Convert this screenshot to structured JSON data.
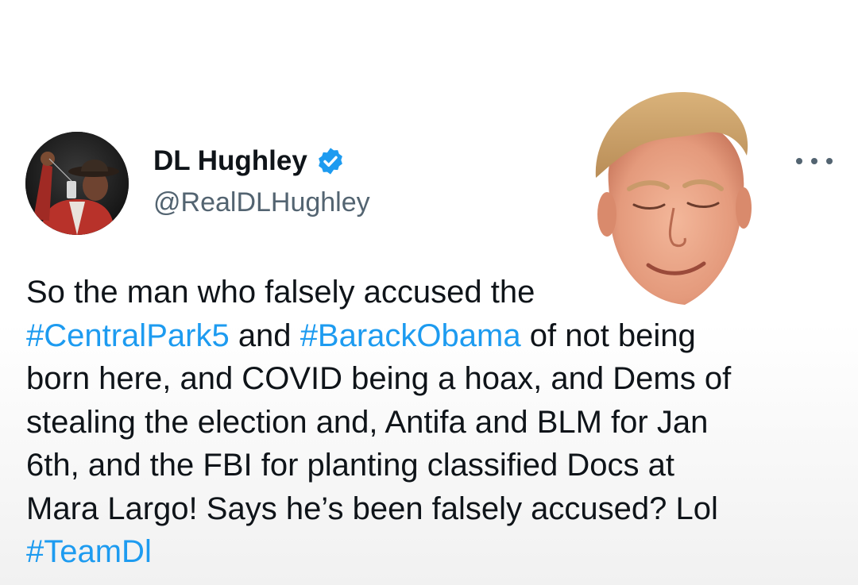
{
  "author": {
    "display_name": "DL Hughley",
    "handle": "@RealDLHughley",
    "verified": true,
    "avatar_icon": "profile-photo"
  },
  "overlay": {
    "icon": "face-cutout-image"
  },
  "menu": {
    "icon": "more-options-icon"
  },
  "tweet": {
    "line1": "So the man who falsely accused the",
    "hashtag_centralpark": "#CentralPark5",
    "and": "and",
    "hashtag_obama": "#BarackObama",
    "line2_rest": "of not being",
    "line3": "born here, and COVID being a hoax, and Dems of",
    "line4": "stealing the election and, Antifa and BLM for Jan",
    "line5": "6th, and the FBI for planting classified Docs at",
    "line6": "Mara Largo! Says he’s been falsely accused? Lol",
    "hashtag_team": "#TeamDl"
  },
  "colors": {
    "link": "#1d9bf0",
    "text": "#0f1419",
    "secondary": "#536471",
    "verified_badge": "#1d9bf0"
  }
}
